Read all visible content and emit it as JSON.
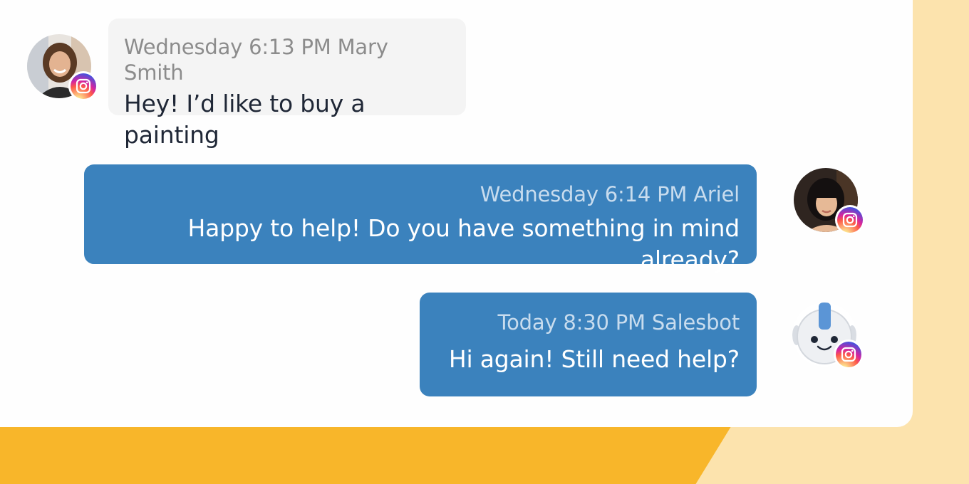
{
  "messages": [
    {
      "direction": "incoming",
      "meta": "Wednesday 6:13 PM Mary Smith",
      "text": "Hey! I’d like to buy a painting",
      "avatar_icon": "person-avatar",
      "channel_icon": "instagram-icon"
    },
    {
      "direction": "outgoing",
      "meta": "Wednesday 6:14 PM Ariel",
      "text": "Happy to help! Do you have something in mind already?",
      "avatar_icon": "person-avatar",
      "channel_icon": "instagram-icon"
    },
    {
      "direction": "outgoing",
      "meta": "Today 8:30 PM Salesbot",
      "text": "Hi again! Still need help?",
      "avatar_icon": "robot-avatar",
      "channel_icon": "instagram-icon"
    }
  ],
  "colors": {
    "outgoing_bubble": "#3b82bd",
    "incoming_bubble": "#f4f4f4",
    "background_accent": "#f8b62a",
    "background_light": "#fce3ad"
  }
}
